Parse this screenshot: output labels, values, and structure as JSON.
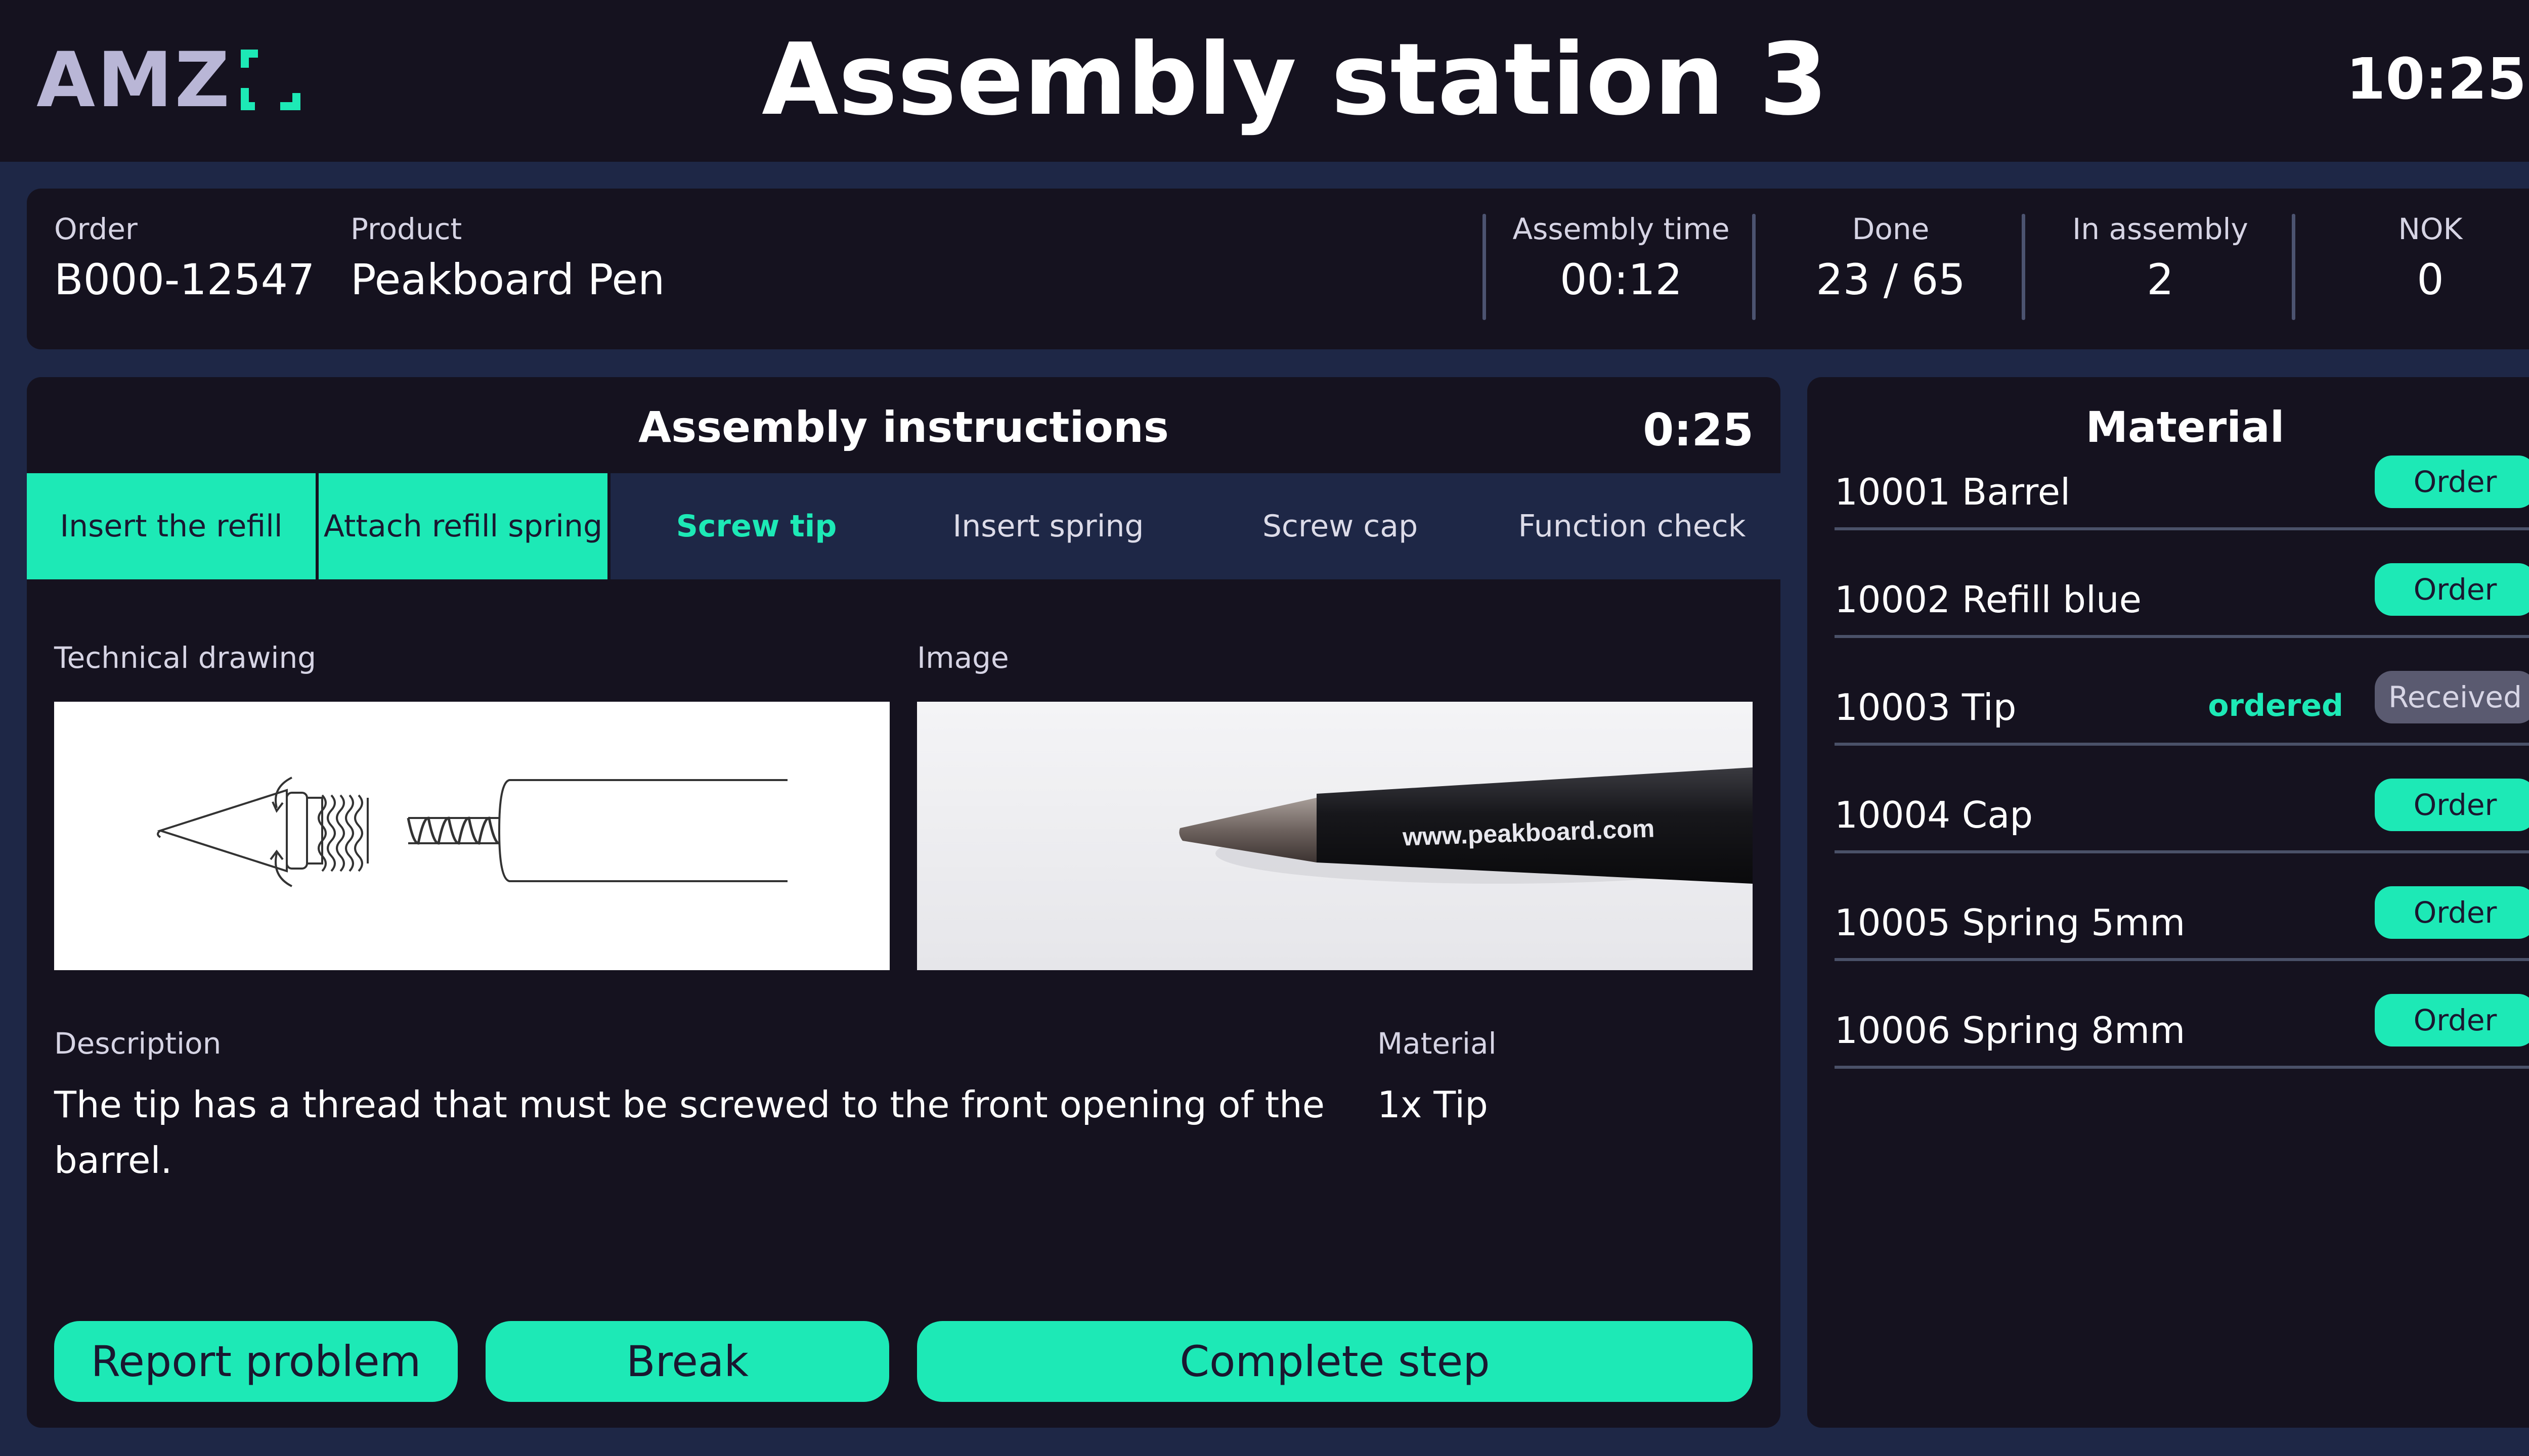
{
  "header": {
    "logo_text": "AMZ",
    "title": "Assembly station 3",
    "clock": "10:25"
  },
  "order_info": {
    "order_label": "Order",
    "order_value": "B000-12547",
    "product_label": "Product",
    "product_value": "Peakboard Pen",
    "stats": [
      {
        "label": "Assembly time",
        "value": "00:12"
      },
      {
        "label": "Done",
        "value": "23 / 65"
      },
      {
        "label": "In assembly",
        "value": "2"
      },
      {
        "label": "NOK",
        "value": "0"
      }
    ]
  },
  "instructions": {
    "title": "Assembly instructions",
    "timer": "0:25",
    "steps": [
      {
        "label": "Insert the refill",
        "state": "done"
      },
      {
        "label": "Attach refill spring",
        "state": "done"
      },
      {
        "label": "Screw tip",
        "state": "active"
      },
      {
        "label": "Insert spring",
        "state": "pending"
      },
      {
        "label": "Screw cap",
        "state": "pending"
      },
      {
        "label": "Function check",
        "state": "pending"
      }
    ],
    "drawing_label": "Technical drawing",
    "image_label": "Image",
    "image_caption": "www.peakboard.com",
    "description_label": "Description",
    "description": "The tip has a thread that must be screwed to the front opening of the barrel.",
    "material_label": "Material",
    "material_value": "1x Tip",
    "buttons": {
      "report": "Report problem",
      "break": "Break",
      "complete": "Complete step"
    }
  },
  "material": {
    "title": "Material",
    "items": [
      {
        "name": "10001 Barrel",
        "status": "",
        "button": "Order"
      },
      {
        "name": "10002 Refill blue",
        "status": "",
        "button": "Order"
      },
      {
        "name": "10003 Tip",
        "status": "ordered",
        "button": "Received"
      },
      {
        "name": "10004 Cap",
        "status": "",
        "button": "Order"
      },
      {
        "name": "10005 Spring 5mm",
        "status": "",
        "button": "Order"
      },
      {
        "name": "10006 Spring 8mm",
        "status": "",
        "button": "Order"
      }
    ]
  },
  "colors": {
    "accent": "#1de9b6",
    "panel": "#15121f",
    "background": "#1e2746"
  }
}
